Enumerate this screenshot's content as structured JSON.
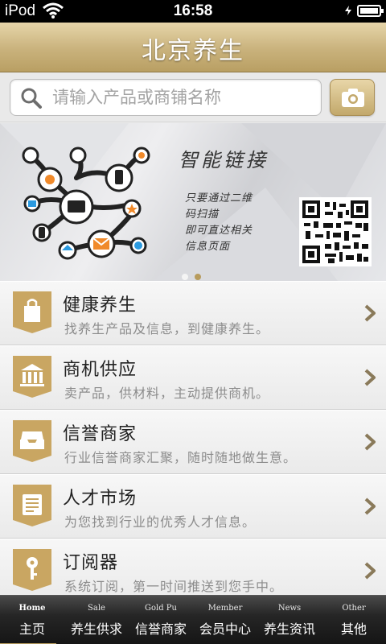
{
  "status_bar": {
    "carrier": "iPod",
    "time": "16:58"
  },
  "header": {
    "title": "北京养生"
  },
  "search": {
    "placeholder": "请输入产品或商铺名称",
    "camera_icon": "camera-icon"
  },
  "banner": {
    "heading": "智能链接",
    "lines": [
      "只要通过二维",
      "码扫描",
      "即可直达相关",
      "信息页面"
    ],
    "pager": {
      "count": 2,
      "active": 2
    }
  },
  "menu": {
    "items": [
      {
        "title": "健康养生",
        "desc": "找养生产品及信息，到健康养生。",
        "icon": "shopping-bag-icon"
      },
      {
        "title": "商机供应",
        "desc": "卖产品，供材料，主动提供商机。",
        "icon": "building-icon"
      },
      {
        "title": "信誉商家",
        "desc": "行业信誉商家汇聚，随时随地做生意。",
        "icon": "inbox-tray-icon"
      },
      {
        "title": "人才市场",
        "desc": "为您找到行业的优秀人才信息。",
        "icon": "document-icon"
      },
      {
        "title": "订阅器",
        "desc": "系统订阅，第一时间推送到您手中。",
        "icon": "key-icon"
      }
    ]
  },
  "tabbar": {
    "tabs": [
      {
        "en": "Home",
        "zh": "主页"
      },
      {
        "en": "Sale",
        "zh": "养生供求"
      },
      {
        "en": "Gold Pu",
        "zh": "信誉商家"
      },
      {
        "en": "Member",
        "zh": "会员中心"
      },
      {
        "en": "News",
        "zh": "养生资讯"
      },
      {
        "en": "Other",
        "zh": "其他"
      }
    ],
    "active_index": 0
  },
  "colors": {
    "accent_gold": "#c2a86b",
    "active_dot": "#b79b5d",
    "tabbar_bg": "#1e1e1e"
  }
}
